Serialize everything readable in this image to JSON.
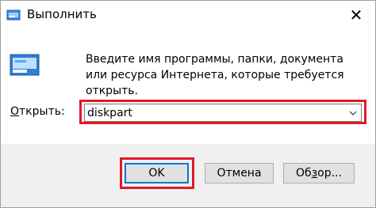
{
  "window": {
    "title": "Выполнить",
    "close_glyph": "✕"
  },
  "description": "Введите имя программы, папки, документа или ресурса Интернета, которые требуется открыть.",
  "open_field": {
    "label_mnemonic": "О",
    "label_rest": "ткрыть:",
    "value": "diskpart"
  },
  "buttons": {
    "ok": "OK",
    "cancel": "Отмена",
    "browse_pre": "Об",
    "browse_mnemonic": "з",
    "browse_post": "ор..."
  },
  "icons": {
    "app": "run-app-icon",
    "run": "run-dialog-icon",
    "dropdown": "chevron-down-icon",
    "close": "close-icon"
  },
  "colors": {
    "highlight": "#e21a28",
    "focus": "#0078d7"
  }
}
